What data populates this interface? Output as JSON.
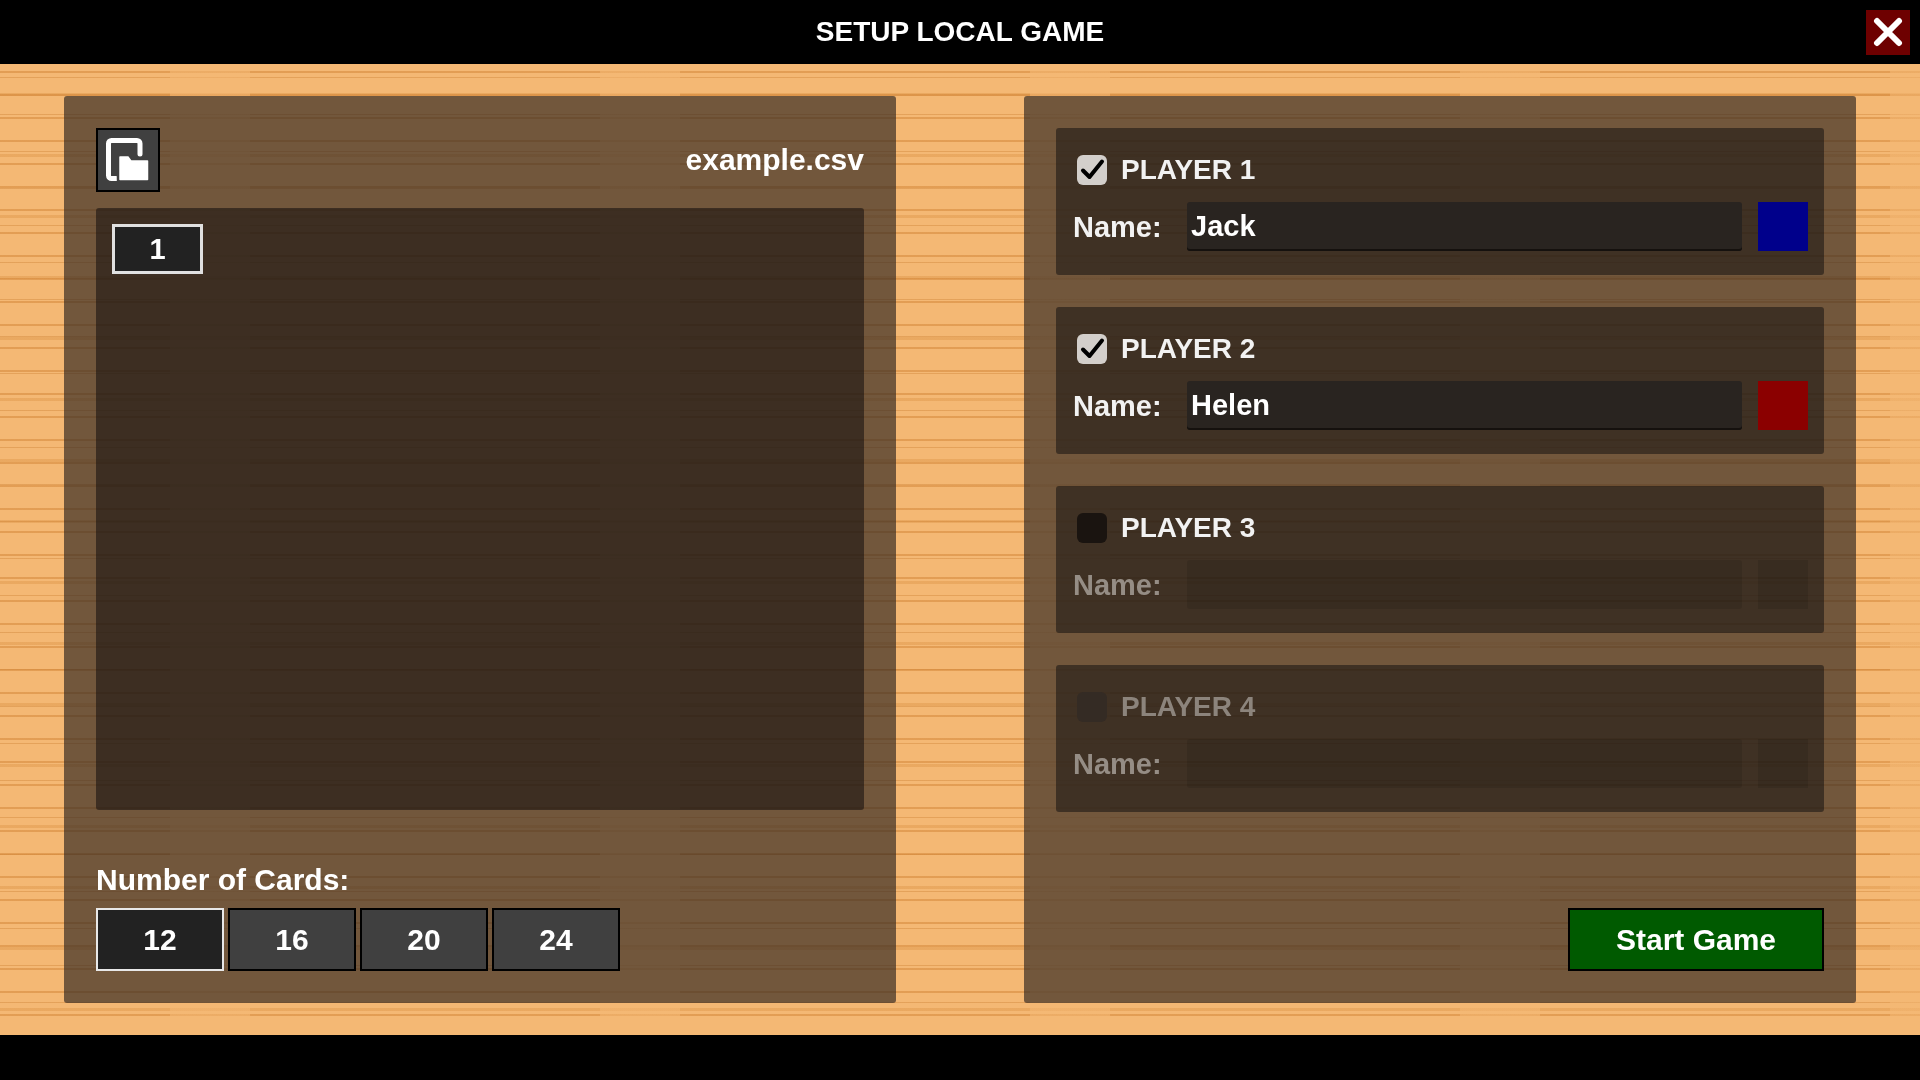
{
  "window": {
    "title": "SETUP LOCAL GAME"
  },
  "file_panel": {
    "file_name": "example.csv",
    "entries": [
      {
        "label": "1",
        "selected": true
      }
    ],
    "card_count": {
      "label": "Number of Cards:",
      "options": [
        {
          "label": "12",
          "selected": true
        },
        {
          "label": "16",
          "selected": false
        },
        {
          "label": "20",
          "selected": false
        },
        {
          "label": "24",
          "selected": false
        }
      ]
    }
  },
  "players_panel": {
    "players": [
      {
        "title": "PLAYER 1",
        "checked": true,
        "disabled": false,
        "name_label": "Name:",
        "name": "Jack",
        "color": "#00008b"
      },
      {
        "title": "PLAYER 2",
        "checked": true,
        "disabled": false,
        "name_label": "Name:",
        "name": "Helen",
        "color": "#8b0000"
      },
      {
        "title": "PLAYER 3",
        "checked": false,
        "disabled": false,
        "name_label": "Name:"
      },
      {
        "title": "PLAYER 4",
        "checked": false,
        "disabled": true,
        "name_label": "Name:"
      }
    ],
    "start_button": "Start Game"
  }
}
